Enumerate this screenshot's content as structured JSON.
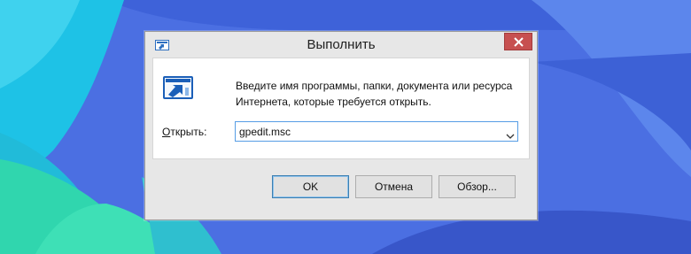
{
  "window": {
    "title": "Выполнить",
    "description": "Введите имя программы, папки, документа или ресурса Интернета, которые требуется открыть.",
    "open_label_key": "О",
    "open_label_rest": "ткрыть:",
    "command_value": "gpedit.msc",
    "buttons": {
      "ok": "OK",
      "cancel": "Отмена",
      "browse": "Обзор..."
    }
  },
  "icons": {
    "title": "run-icon",
    "close": "close-icon",
    "dropdown": "chevron-down-icon",
    "large": "run-icon"
  },
  "colors": {
    "close_button": "#c75050",
    "input_border": "#569de5",
    "desktop_blue": "#4a6fe0",
    "desktop_teal": "#2fd0b0"
  }
}
